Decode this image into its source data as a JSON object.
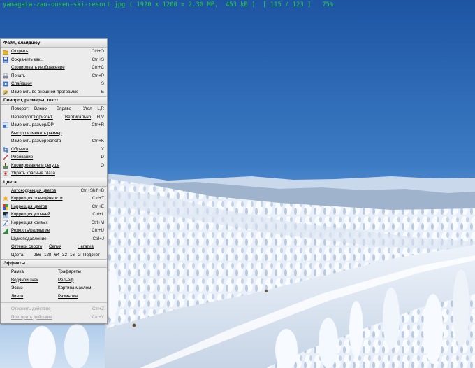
{
  "info_bar": {
    "filename": "yamagata-zao-onsen-ski-resort.jpg",
    "dimensions": "( 1920 x 1200 = 2.30 MP",
    "filesize": "453 kB )",
    "position": "[ 115 / 123 ]",
    "zoom": "75%"
  },
  "menu": {
    "file_section": {
      "title": "Файл, слайдшоу",
      "items": [
        {
          "label": "Открыть",
          "shortcut": "Ctrl+O",
          "icon": "folder-icon"
        },
        {
          "label": "Сохранить как...",
          "shortcut": "Ctrl+S",
          "icon": "save-disk-icon"
        },
        {
          "label": "Скопировать изображение",
          "shortcut": "Ctrl+C",
          "icon": ""
        },
        {
          "label": "Печать",
          "shortcut": "Ctrl+P",
          "icon": "printer-icon"
        },
        {
          "label": "Слайдшоу",
          "shortcut": "S",
          "icon": "slideshow-icon"
        },
        {
          "label": "Изменить во внешней программе",
          "shortcut": "E",
          "icon": "external-edit-icon"
        }
      ]
    },
    "transform_section": {
      "title": "Поворот, размеры, текст",
      "rotate": {
        "label": "Поворот:",
        "left": "Влево",
        "right": "Вправо",
        "angle": "Угол",
        "shortcut": "L,R"
      },
      "flip": {
        "label": "Переворот:",
        "horizontal": "Горизонт.",
        "vertical": "Вертикально",
        "shortcut": "H,V"
      },
      "items": [
        {
          "label": "Изменить размер/DPI",
          "shortcut": "Ctrl+R",
          "icon": "resize-icon"
        },
        {
          "label": "Быстро изменить размер",
          "shortcut": "",
          "icon": ""
        },
        {
          "label": "Изменить размер холста",
          "shortcut": "Ctrl+K",
          "icon": ""
        },
        {
          "label": "Обрезка",
          "shortcut": "X",
          "icon": "crop-icon"
        },
        {
          "label": "Рисование",
          "shortcut": "D",
          "icon": "paint-icon"
        },
        {
          "label": "Клонирование и ретушь",
          "shortcut": "O",
          "icon": "clone-stamp-icon"
        },
        {
          "label": "Убрать красные глаза",
          "shortcut": "",
          "icon": "red-eye-icon"
        }
      ]
    },
    "colors_section": {
      "title": "Цвета",
      "items": [
        {
          "label": "Автокоррекция цветов",
          "shortcut": "Ctrl+Shift+B",
          "icon": ""
        },
        {
          "label": "Коррекция освещённости",
          "shortcut": "Ctrl+T",
          "icon": "sun-icon"
        },
        {
          "label": "Коррекция цветов",
          "shortcut": "Ctrl+E",
          "icon": "color-balance-icon"
        },
        {
          "label": "Коррекция уровней",
          "shortcut": "Ctrl+L",
          "icon": "levels-icon"
        },
        {
          "label": "Коррекция кривых",
          "shortcut": "Ctrl+M",
          "icon": "curves-icon"
        },
        {
          "label": "Резкость/размытие",
          "shortcut": "Ctrl+U",
          "icon": "sharpen-icon"
        },
        {
          "label": "Шумоподавление",
          "shortcut": "Ctrl+J",
          "icon": ""
        }
      ],
      "gray_row": {
        "gray": "Оттенки серого",
        "sepia": "Сепия",
        "negative": "Негатив"
      },
      "count_row": {
        "label": "Цвета:",
        "v1": "256",
        "v2": "128",
        "v3": "64",
        "v4": "32",
        "v5": "16",
        "v6": "G",
        "count": "Подсчёт"
      }
    },
    "effects_section": {
      "title": "Эффекты",
      "rows": [
        {
          "left": "Рамка",
          "right": "Трафареты"
        },
        {
          "left": "Водяной знак",
          "right": "Рельеф"
        },
        {
          "left": "Эскиз",
          "right": "Картина маслом"
        },
        {
          "left": "Линза",
          "right": "Размытие"
        }
      ]
    },
    "history": {
      "undo": {
        "label": "Отменить действие",
        "shortcut": "Ctrl+Z"
      },
      "redo": {
        "label": "Повторить действие",
        "shortcut": "Ctrl+Y"
      }
    }
  },
  "colors": {
    "info_text": "#27d23a",
    "menu_bg": "#ececec"
  }
}
